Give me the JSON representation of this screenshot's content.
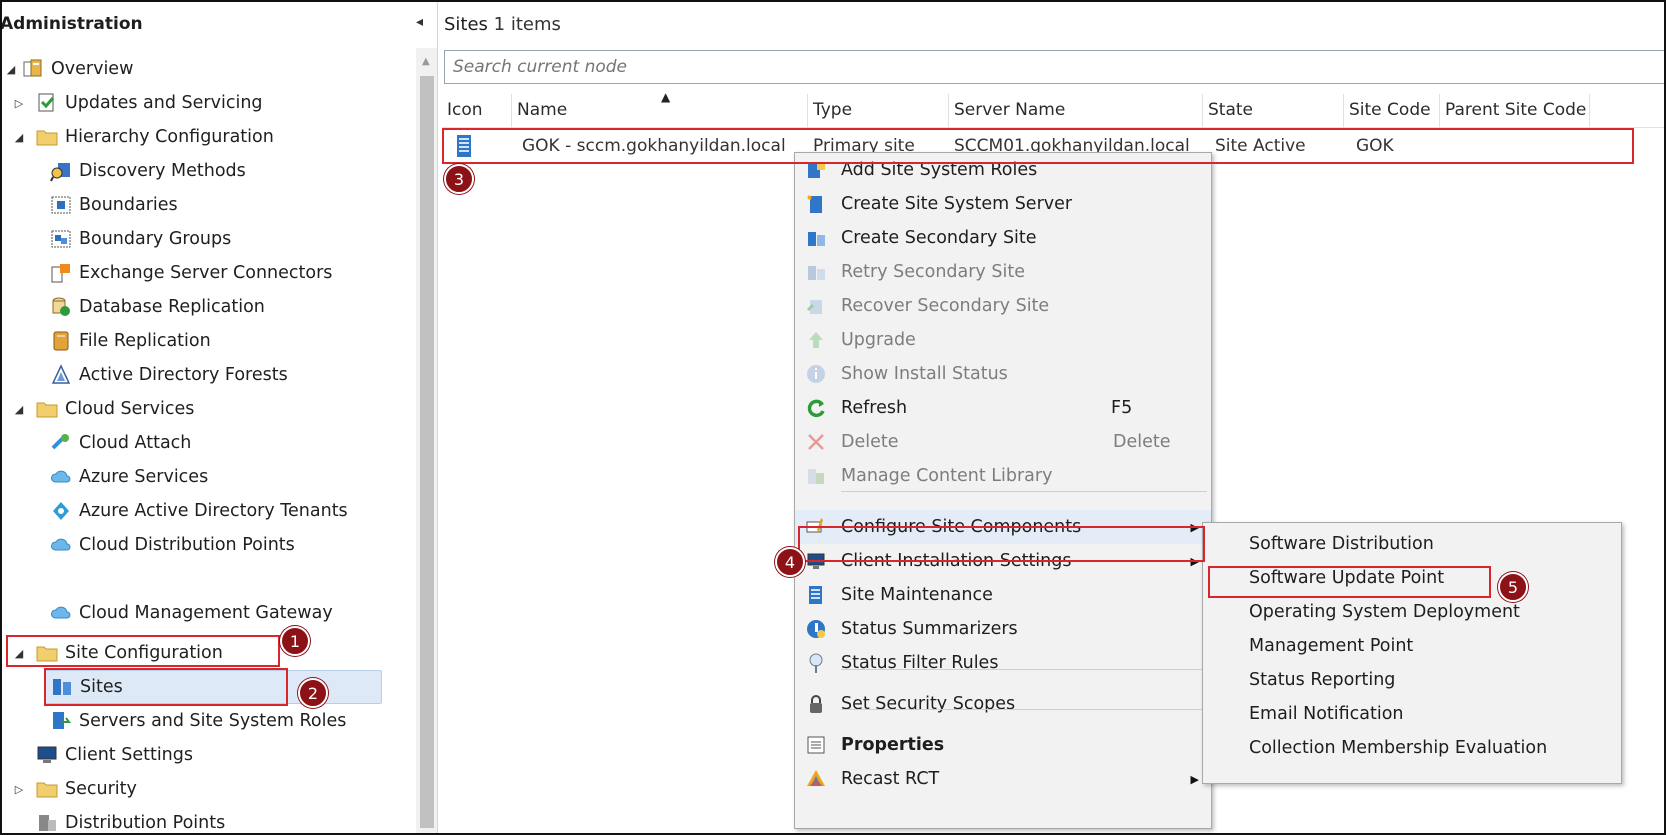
{
  "nav": {
    "title": "Administration",
    "collapse_glyph": "◂",
    "items": [
      {
        "label": "Overview",
        "icon": "overview-icon",
        "arrow": "◢"
      },
      {
        "label": "Updates and Servicing",
        "icon": "updates-icon",
        "arrow": "▷"
      },
      {
        "label": "Hierarchy Configuration",
        "icon": "folder-icon",
        "arrow": "◢"
      },
      {
        "label": "Discovery Methods",
        "icon": "discovery-icon"
      },
      {
        "label": "Boundaries",
        "icon": "boundary-icon"
      },
      {
        "label": "Boundary Groups",
        "icon": "boundary-group-icon"
      },
      {
        "label": "Exchange Server Connectors",
        "icon": "exchange-icon"
      },
      {
        "label": "Database Replication",
        "icon": "database-icon"
      },
      {
        "label": "File Replication",
        "icon": "file-replication-icon"
      },
      {
        "label": "Active Directory Forests",
        "icon": "forest-icon"
      },
      {
        "label": "Cloud Services",
        "icon": "folder-icon",
        "arrow": "◢"
      },
      {
        "label": "Cloud Attach",
        "icon": "cloud-attach-icon"
      },
      {
        "label": "Azure Services",
        "icon": "cloud-icon"
      },
      {
        "label": "Azure Active Directory Tenants",
        "icon": "tenant-icon"
      },
      {
        "label": "Cloud Distribution Points",
        "icon": "cloud-icon"
      },
      {
        "label": "Cloud Management Gateway",
        "icon": "cloud-icon"
      },
      {
        "label": "Site Configuration",
        "icon": "folder-icon",
        "arrow": "◢"
      },
      {
        "label": "Sites",
        "icon": "sites-icon"
      },
      {
        "label": "Servers and Site System Roles",
        "icon": "server-roles-icon"
      },
      {
        "label": "Client Settings",
        "icon": "client-settings-icon"
      },
      {
        "label": "Security",
        "icon": "folder-icon",
        "arrow": "▷"
      },
      {
        "label": "Distribution Points",
        "icon": "distribution-icon"
      }
    ]
  },
  "main": {
    "title": "Sites",
    "count": "1 items",
    "search_placeholder": "Search current node",
    "columns": [
      "Icon",
      "Name",
      "Type",
      "Server Name",
      "State",
      "Site Code",
      "Parent Site Code"
    ],
    "row": {
      "name": "GOK - sccm.gokhanyildan.local",
      "type": "Primary site",
      "server": "SCCM01.gokhanyildan.local",
      "state": "Site Active",
      "site_code": "GOK",
      "parent_site_code": ""
    }
  },
  "context_menu": {
    "items": [
      {
        "label": "Add Site System Roles",
        "icon": "add-roles-icon"
      },
      {
        "label": "Create Site System Server",
        "icon": "create-server-icon"
      },
      {
        "label": "Create Secondary Site",
        "icon": "secondary-site-icon"
      },
      {
        "label": "Retry Secondary Site",
        "icon": "retry-icon",
        "disabled": true
      },
      {
        "label": "Recover Secondary Site",
        "icon": "recover-icon",
        "disabled": true
      },
      {
        "label": "Upgrade",
        "icon": "upgrade-icon",
        "disabled": true
      },
      {
        "label": "Show Install Status",
        "icon": "info-icon",
        "disabled": true
      },
      {
        "label": "Refresh",
        "icon": "refresh-icon",
        "shortcut": "F5"
      },
      {
        "label": "Delete",
        "icon": "delete-icon",
        "shortcut": "Delete",
        "disabled": true
      },
      {
        "label": "Manage Content Library",
        "icon": "content-library-icon",
        "disabled": true
      },
      {
        "label": "Configure Site Components",
        "icon": "configure-icon",
        "submenu": true
      },
      {
        "label": "Client Installation Settings",
        "icon": "client-install-icon",
        "submenu": true
      },
      {
        "label": "Site Maintenance",
        "icon": "maintenance-icon"
      },
      {
        "label": "Status Summarizers",
        "icon": "status-summarizer-icon"
      },
      {
        "label": "Status Filter Rules",
        "icon": "filter-rules-icon"
      },
      {
        "label": "Set Security Scopes",
        "icon": "lock-icon"
      },
      {
        "label": "Properties",
        "icon": "properties-icon",
        "bold": true
      },
      {
        "label": "Recast RCT",
        "icon": "recast-icon",
        "submenu": true
      }
    ],
    "submenu_glyph": "▶"
  },
  "submenu": {
    "items": [
      "Software Distribution",
      "Software Update Point",
      "Operating System Deployment",
      "Management Point",
      "Status Reporting",
      "Email Notification",
      "Collection Membership Evaluation"
    ]
  },
  "badges": [
    "1",
    "2",
    "3",
    "4",
    "5"
  ],
  "colors": {
    "highlight": "#d8262c",
    "badge": "#8c1218",
    "selection": "#dde9f7"
  }
}
